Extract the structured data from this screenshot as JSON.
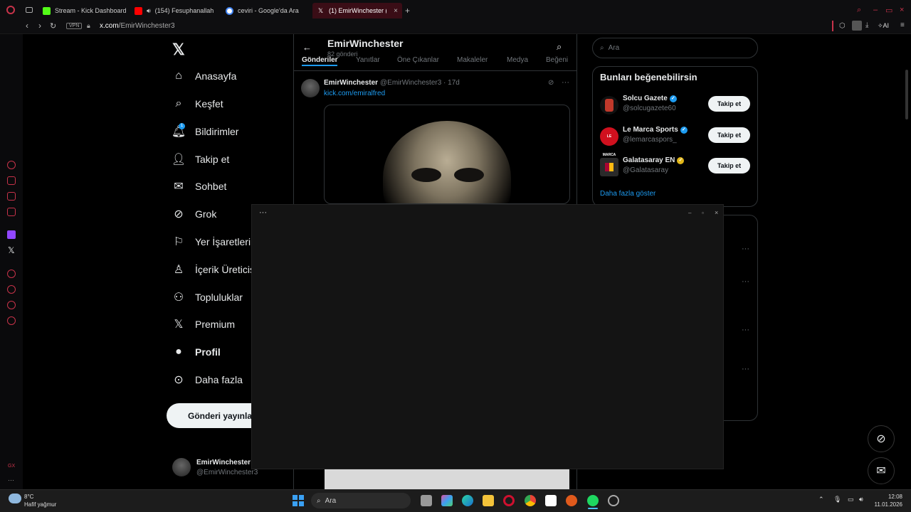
{
  "browser": {
    "tabs": [
      {
        "label": "Stream - Kick Dashboard",
        "color": "#53fc18"
      },
      {
        "label": "(154) Fesuphanallah -",
        "color": "#ff0000"
      },
      {
        "label": "ceviri - Google'da Ara",
        "color": "#4285f4"
      },
      {
        "label": "(1) EmirWinchester (@Emi",
        "color": "#ffffff"
      }
    ],
    "vpn": "VPN",
    "url_domain": "x.com",
    "url_path": "/EmirWinchester3",
    "ai_label": "AI"
  },
  "nav": {
    "items": [
      {
        "label": "Anasayfa",
        "icon": "home-icon",
        "glyph": "⌂"
      },
      {
        "label": "Keşfet",
        "icon": "search-icon",
        "glyph": "⌕"
      },
      {
        "label": "Bildirimler",
        "icon": "bell-icon",
        "glyph": "🔔︎"
      },
      {
        "label": "Takip et",
        "icon": "add-user-icon",
        "glyph": "👤︎"
      },
      {
        "label": "Sohbet",
        "icon": "mail-icon",
        "glyph": "✉"
      },
      {
        "label": "Grok",
        "icon": "grok-icon",
        "glyph": "⊘"
      },
      {
        "label": "Yer İşaretleri",
        "icon": "bookmark-icon",
        "glyph": "⚐"
      },
      {
        "label": "İçerik Üreticis",
        "icon": "creator-icon",
        "glyph": "♙"
      },
      {
        "label": "Topluluklar",
        "icon": "communities-icon",
        "glyph": "⚇"
      },
      {
        "label": "Premium",
        "icon": "x-logo-icon",
        "glyph": "𝕏"
      },
      {
        "label": "Profil",
        "icon": "profile-icon",
        "glyph": "●"
      },
      {
        "label": "Daha fazla",
        "icon": "more-icon",
        "glyph": "⊙"
      }
    ],
    "notification_badge": "1",
    "post_button": "Gönderi yayınla",
    "account_name": "EmirWinchester",
    "account_handle": "@EmirWinchester3"
  },
  "profile": {
    "name": "EmirWinchester",
    "posts": "82 gönderi",
    "tabs": [
      "Gönderiler",
      "Yanıtlar",
      "Öne Çıkanlar",
      "Makaleler",
      "Medya",
      "Beğeni"
    ]
  },
  "tweet": {
    "author": "EmirWinchester",
    "handle": "@EmirWinchester3 · 17d",
    "link": "kick.com/emiralfred"
  },
  "right": {
    "search_placeholder": "Ara",
    "suggestions_title": "Bunları beğenebilirsin",
    "suggestions": [
      {
        "name": "Solcu Gazete",
        "handle": "@solcugazete60",
        "badge_color": "#1d9bf0",
        "avatar_color": "#c0392b",
        "follow": "Takip et"
      },
      {
        "name": "Le Marca Sports",
        "handle": "@lemarcaspors_",
        "badge_color": "#1d9bf0",
        "avatar_color": "#d0101e",
        "follow": "Takip et"
      },
      {
        "name": "Galatasaray EN",
        "handle": "@Galatasaray",
        "badge_color": "#e2b719",
        "avatar_color": "#2a2a2a",
        "follow": "Takip et"
      }
    ],
    "more": "Daha fazla göster"
  },
  "overlay": {
    "menu": "···",
    "minimize": "–",
    "maximize": "▫",
    "close": "×"
  },
  "taskbar": {
    "weather_temp": "8°C",
    "weather_desc": "Hafif yağmur",
    "search": "Ara",
    "time": "12:08",
    "date": "11.01.2026"
  }
}
